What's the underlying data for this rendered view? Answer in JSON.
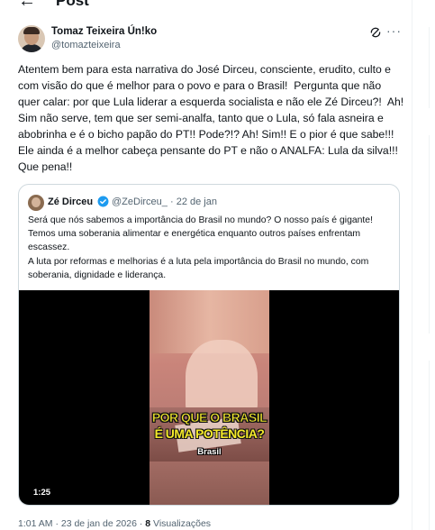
{
  "header": {
    "title": "Post",
    "back_icon": "arrow-left-icon"
  },
  "post": {
    "author_name": "Tomaz Teixeira Ún!ko",
    "author_handle": "@tomazteixeira",
    "text": "Atentem bem para esta narrativa do José Dirceu, consciente, erudito, culto e com visão do que é melhor para o povo e para o Brasil!  Pergunta que não quer calar: por que Lula liderar a esquerda socialista e não ele Zé Dirceu?!  Ah! Sim não serve, tem que ser semi-analfa, tanto que o Lula, só fala asneira e abobrinha e é o bicho papão do PT!! Pode?!? Ah! Sim!! E o pior é que sabe!!! Ele ainda é a melhor cabeça pensante do PT e não o ANALFA: Lula da silva!!! Que pena!!",
    "timestamp": "1:01 AM · 23 de jan de 2026 · ",
    "views_count": "8",
    "views_label": " Visualizações"
  },
  "quote": {
    "author_name": "Zé Dirceu",
    "author_handle": "@ZeDirceu_",
    "date": "22 de jan",
    "text": "Será que nós sabemos a importância do Brasil no mundo? O nosso país é gigante! Temos uma soberania alimentar e energética enquanto outros países enfrentam escassez.\nA luta por reformas e melhorias é a luta pela importância do Brasil no mundo, com soberania, dignidade e liderança.",
    "video": {
      "caption_line1": "POR QUE O BRASIL",
      "caption_line2": "É UMA POTÊNCIA?",
      "caption_word": "Brasil",
      "duration": "1:25"
    }
  },
  "colors": {
    "text_primary": "#0f1419",
    "text_secondary": "#536471",
    "border": "#cfd9de",
    "verified": "#1d9bf0",
    "caption": "#f5ea2b"
  }
}
